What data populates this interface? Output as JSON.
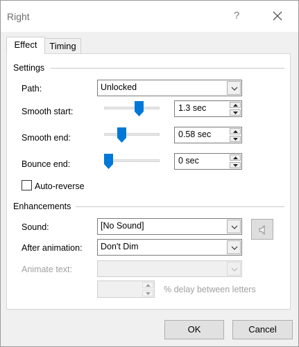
{
  "window": {
    "title": "Right",
    "help_glyph": "?"
  },
  "tabs": {
    "effect": {
      "label": "Effect",
      "active": true
    },
    "timing": {
      "label": "Timing",
      "active": false
    }
  },
  "settings": {
    "group_label": "Settings",
    "path": {
      "label": "Path:",
      "value": "Unlocked"
    },
    "smooth_start": {
      "label": "Smooth start:",
      "value": "1.3 sec",
      "slider_fraction": 0.65
    },
    "smooth_end": {
      "label": "Smooth end:",
      "value": "0.58 sec",
      "slider_fraction": 0.29
    },
    "bounce_end": {
      "label": "Bounce end:",
      "value": "0 sec",
      "slider_fraction": 0
    },
    "auto_reverse": {
      "label": "Auto-reverse",
      "checked": false
    }
  },
  "enhancements": {
    "group_label": "Enhancements",
    "sound": {
      "label": "Sound:",
      "value": "[No Sound]"
    },
    "after_animation": {
      "label": "After animation:",
      "value": "Don't Dim"
    },
    "animate_text": {
      "label": "Animate text:",
      "value": ""
    },
    "delay": {
      "value": "",
      "label": "% delay between letters"
    }
  },
  "buttons": {
    "ok": "OK",
    "cancel": "Cancel"
  },
  "colors": {
    "slider_thumb": "#0078d7",
    "disabled_text": "#a0a0a0"
  }
}
